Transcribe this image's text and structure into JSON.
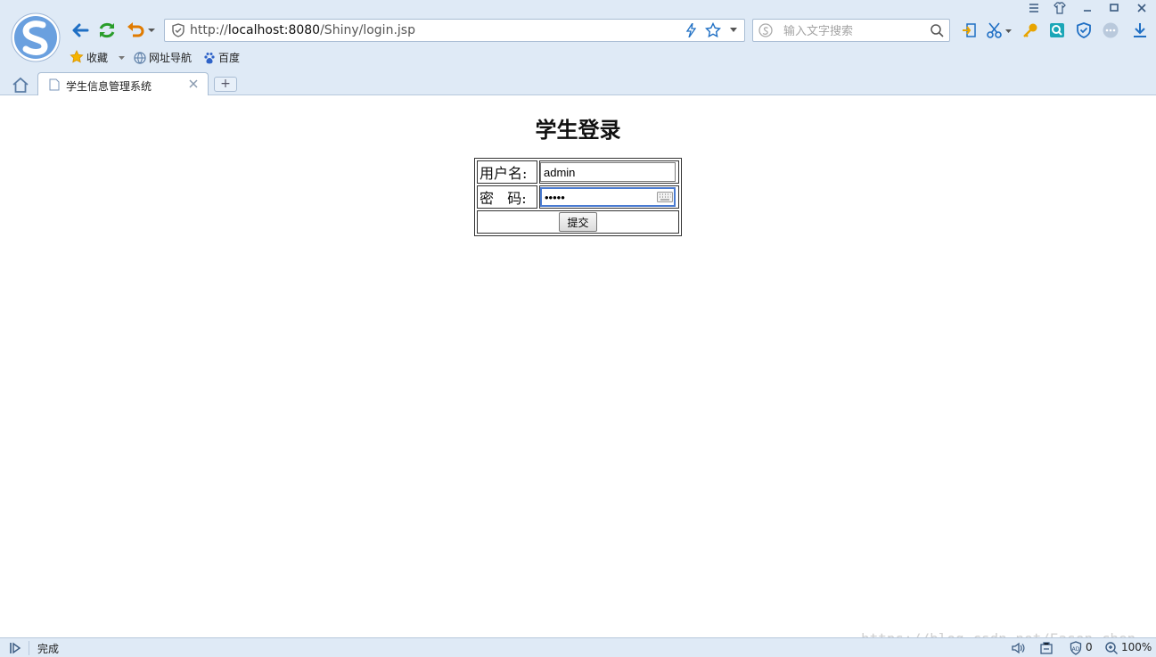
{
  "browser": {
    "address": {
      "scheme": "http://",
      "host": "localhost:8080",
      "path": "/Shiny/login.jsp"
    },
    "search": {
      "placeholder": "输入文字搜索"
    },
    "bookmarks": [
      {
        "label": "收藏",
        "icon": "star-icon"
      },
      {
        "label": "网址导航",
        "icon": "globe-icon"
      },
      {
        "label": "百度",
        "icon": "paw-icon"
      }
    ],
    "tab": {
      "title": "学生信息管理系统"
    },
    "new_tab_label": "+"
  },
  "page": {
    "heading": "学生登录",
    "form": {
      "username_label": "用户名:",
      "username_value": "admin",
      "password_label": "密   码:",
      "password_value": "•••••",
      "submit_label": "提交"
    }
  },
  "statusbar": {
    "status": "完成",
    "ad_count": "0",
    "zoom": "100%"
  },
  "watermark": "https://blog.csdn.net/Eason_chen",
  "colors": {
    "chrome_bg": "#dfeaf6",
    "accent_blue": "#1f6fc4",
    "refresh_green": "#2a9d2a",
    "undo_orange": "#e07b00"
  }
}
